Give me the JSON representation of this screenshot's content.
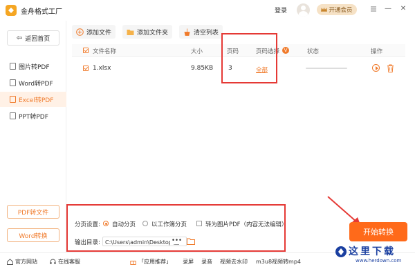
{
  "app": {
    "title": "金舟格式工厂"
  },
  "titlebar": {
    "login": "登录",
    "vip": "开通会员",
    "minimize": "—",
    "close": "✕"
  },
  "sidebar": {
    "back": "返回首页",
    "items": [
      {
        "label": "图片转PDF"
      },
      {
        "label": "Word转PDF"
      },
      {
        "label": "Excel转PDF"
      },
      {
        "label": "PPT转PDF"
      }
    ],
    "bottom_buttons": [
      "PDF转文件",
      "Word转换"
    ]
  },
  "toolbar": {
    "add_file": "添加文件",
    "add_folder": "添加文件夹",
    "clear_list": "清空列表"
  },
  "table": {
    "headers": {
      "name": "文件名称",
      "size": "大小",
      "pages": "页码",
      "page_select": "页码选择",
      "status": "状态",
      "actions": "操作"
    },
    "rows": [
      {
        "name": "1.xlsx",
        "size": "9.85KB",
        "pages": "3",
        "range": "全部",
        "progress": 0
      }
    ]
  },
  "settings": {
    "pagination_label": "分页设置:",
    "auto_page": "自动分页",
    "sheet_page": "以工作簿分页",
    "to_image": "转为图片PDF（内容无法编辑）",
    "output_label": "输出目录:",
    "output_path": "C:\\Users\\admin\\Desktop\\金",
    "more": "•••"
  },
  "start_button": "开始转换",
  "footer": {
    "site": "官方网站",
    "service": "在线客服",
    "recommend": "「应用推荐」",
    "links": [
      "录屏",
      "录音",
      "视频去水印",
      "m3u8视频转mp4"
    ]
  },
  "watermark": {
    "name": "这里下载",
    "url": "www.herdown.com"
  },
  "colors": {
    "accent": "#f07a2a",
    "start": "#ff6a1a",
    "highlight_box": "#e53935"
  }
}
